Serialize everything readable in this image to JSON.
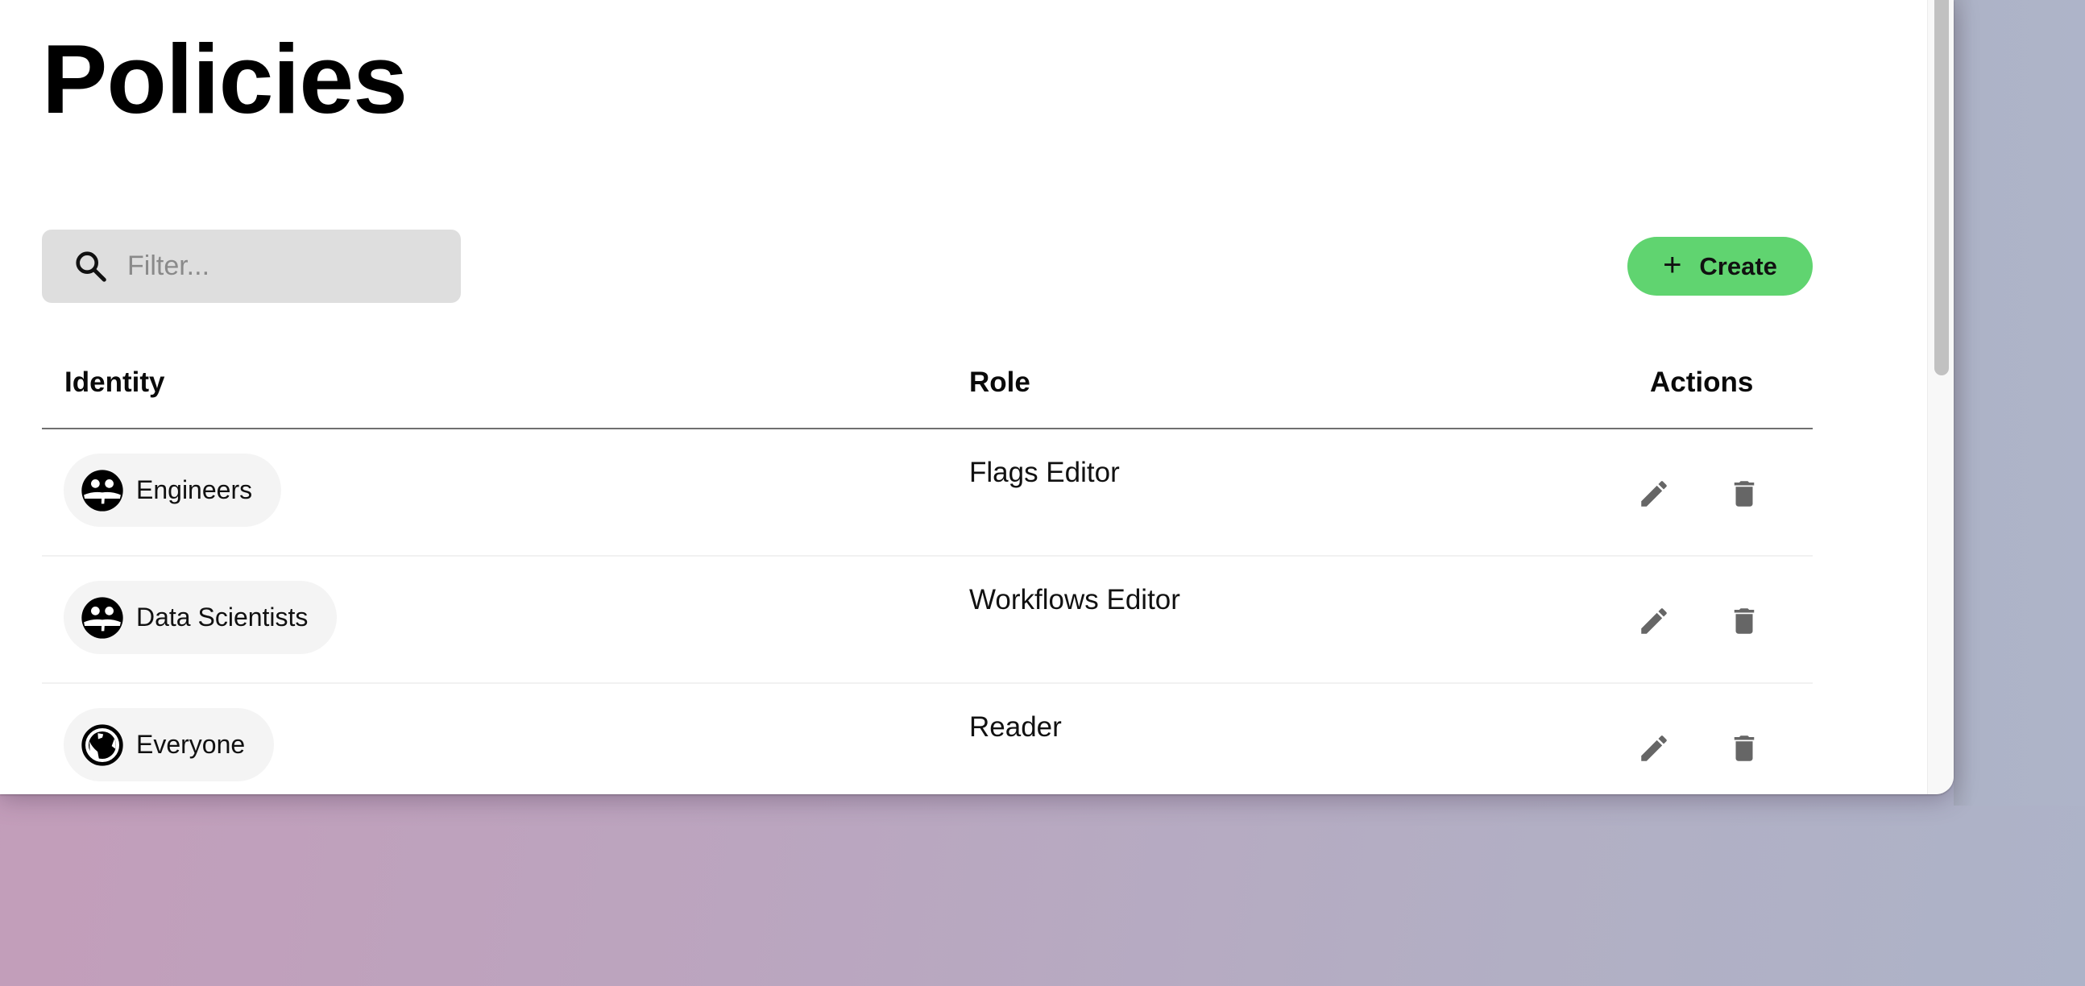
{
  "page": {
    "title": "Policies"
  },
  "toolbar": {
    "filter_placeholder": "Filter...",
    "filter_value": "",
    "create_label": "Create",
    "create_icon": "plus-icon",
    "create_color": "#60d470"
  },
  "table": {
    "headers": {
      "identity": "Identity",
      "role": "Role",
      "actions": "Actions"
    },
    "rows": [
      {
        "identity": "Engineers",
        "identity_icon": "group-icon",
        "role": "Flags Editor"
      },
      {
        "identity": "Data Scientists",
        "identity_icon": "group-icon",
        "role": "Workflows Editor"
      },
      {
        "identity": "Everyone",
        "identity_icon": "globe-icon",
        "role": "Reader"
      }
    ],
    "row_actions": [
      "edit-icon",
      "trash-icon"
    ]
  }
}
